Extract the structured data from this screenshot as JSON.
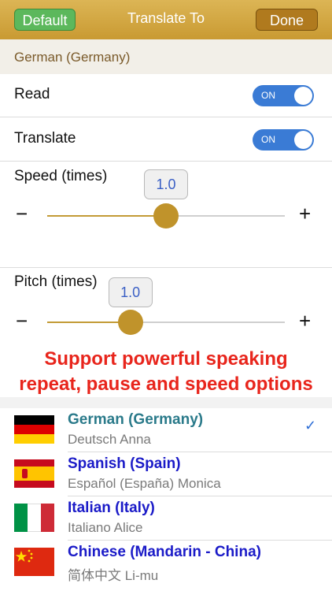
{
  "navbar": {
    "default_label": "Default",
    "title": "Translate To",
    "done_label": "Done"
  },
  "section": {
    "header": "German (Germany)"
  },
  "read": {
    "label": "Read",
    "toggle": "ON"
  },
  "translate": {
    "label": "Translate",
    "toggle": "ON"
  },
  "speed": {
    "label": "Speed (times)",
    "value": "1.0",
    "minus": "−",
    "plus": "+",
    "fraction": 0.5
  },
  "pitch": {
    "label": "Pitch (times)",
    "value": "1.0",
    "minus": "−",
    "plus": "+",
    "fraction": 0.35
  },
  "promo": {
    "line1": "Support powerful speaking",
    "line2": "repeat, pause and speed options"
  },
  "languages": [
    {
      "name": "German (Germany)",
      "voice": "Deutsch Anna",
      "selected": true,
      "name_color": "#2a7a8a"
    },
    {
      "name": "Spanish (Spain)",
      "voice": "Español (España)  Monica",
      "selected": false,
      "name_color": "#1b1bc8"
    },
    {
      "name": "Italian (Italy)",
      "voice": "Italiano Alice",
      "selected": false,
      "name_color": "#1b1bc8"
    },
    {
      "name": "Chinese (Mandarin - China)",
      "voice": "简体中文 Li-mu",
      "selected": false,
      "name_color": "#1b1bc8"
    }
  ],
  "check_mark": "✓",
  "icons": [
    "check-icon",
    "flag-germany-icon",
    "flag-spain-icon",
    "flag-italy-icon",
    "flag-china-icon"
  ]
}
